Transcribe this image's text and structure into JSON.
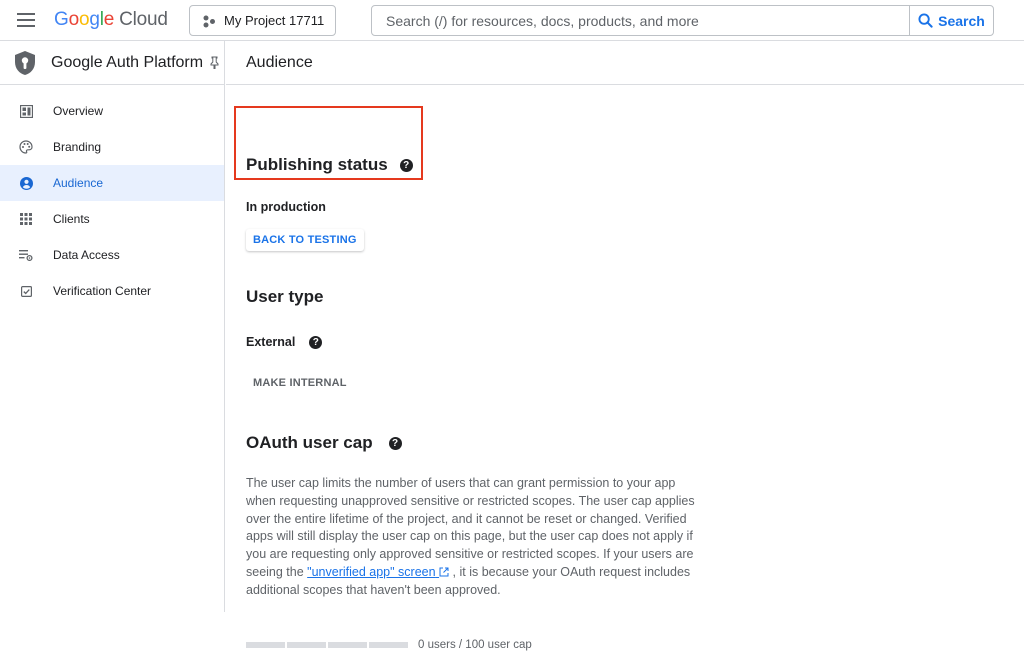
{
  "topbar": {
    "logo_google": [
      "G",
      "o",
      "o",
      "g",
      "l",
      "e"
    ],
    "logo_cloud": "Cloud",
    "project_name": "My Project 17711",
    "search_placeholder": "Search (/) for resources, docs, products, and more",
    "search_button": "Search"
  },
  "sidebar": {
    "title": "Google Auth Platform",
    "items": [
      {
        "label": "Overview",
        "icon": "dashboard-icon",
        "active": false
      },
      {
        "label": "Branding",
        "icon": "palette-icon",
        "active": false
      },
      {
        "label": "Audience",
        "icon": "account-circle-icon",
        "active": true
      },
      {
        "label": "Clients",
        "icon": "grid-dots-icon",
        "active": false
      },
      {
        "label": "Data Access",
        "icon": "list-settings-icon",
        "active": false
      },
      {
        "label": "Verification Center",
        "icon": "checkbox-icon",
        "active": false
      }
    ]
  },
  "main": {
    "page_title": "Audience",
    "publishing": {
      "heading": "Publishing status",
      "status": "In production",
      "button": "BACK TO TESTING"
    },
    "user_type": {
      "heading": "User type",
      "value": "External",
      "button": "MAKE INTERNAL"
    },
    "user_cap": {
      "heading": "OAuth user cap",
      "para_before_link": "The user cap limits the number of users that can grant permission to your app when requesting unapproved sensitive or restricted scopes. The user cap applies over the entire lifetime of the project, and it cannot be reset or changed. Verified apps will still display the user cap on this page, but the user cap does not apply if you are requesting only approved sensitive or restricted scopes. If your users are seeing the ",
      "link_text": "\"unverified app\" screen",
      "para_after_link": " , it is because your OAuth request includes additional scopes that haven't been approved.",
      "progress_label": "0 users / 100 user cap",
      "progress_value": 0
    }
  },
  "colors": {
    "accent": "#1a73e8",
    "active_bg": "#e8f0fe",
    "highlight": "#e5391e"
  }
}
